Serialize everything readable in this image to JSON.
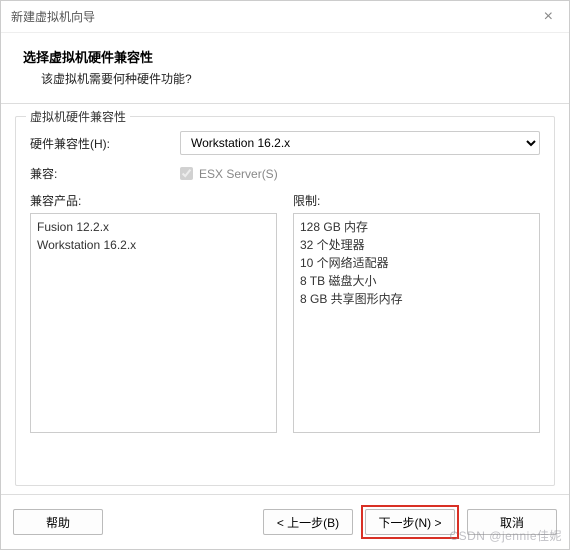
{
  "titlebar": {
    "title": "新建虚拟机向导",
    "close": "×"
  },
  "header": {
    "title": "选择虚拟机硬件兼容性",
    "subtitle": "该虚拟机需要何种硬件功能?"
  },
  "fieldset": {
    "legend": "虚拟机硬件兼容性",
    "hw_label": "硬件兼容性(H):",
    "hw_value": "Workstation 16.2.x",
    "compat_label": "兼容:",
    "esx_label": "ESX Server(S)",
    "products_label": "兼容产品:",
    "limits_label": "限制:",
    "products": [
      "Fusion 12.2.x",
      "Workstation 16.2.x"
    ],
    "limits": [
      "128 GB 内存",
      "32 个处理器",
      "10 个网络适配器",
      "8 TB 磁盘大小",
      "8 GB 共享图形内存"
    ]
  },
  "footer": {
    "help": "帮助",
    "back": "< 上一步(B)",
    "next": "下一步(N) >",
    "cancel": "取消"
  },
  "watermark": "CSDN @jennie佳妮"
}
